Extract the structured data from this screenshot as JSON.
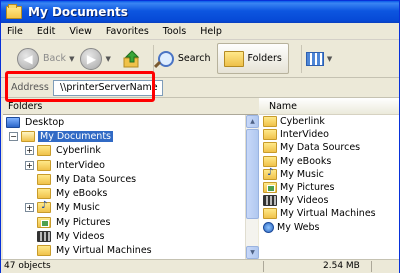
{
  "window": {
    "title": "My Documents"
  },
  "menubar": {
    "items": [
      "File",
      "Edit",
      "View",
      "Favorites",
      "Tools",
      "Help"
    ]
  },
  "toolbar": {
    "back_label": "Back",
    "search_label": "Search",
    "folders_label": "Folders"
  },
  "address": {
    "label": "Address",
    "value": "\\\\printerServerName"
  },
  "folders_pane": {
    "title": "Folders",
    "tree": [
      {
        "label": "Desktop",
        "icon": "desktop-icon"
      },
      {
        "label": "My Documents",
        "icon": "my-documents-icon",
        "selected": true
      },
      {
        "label": "Cyberlink",
        "icon": "folder-icon"
      },
      {
        "label": "InterVideo",
        "icon": "folder-icon"
      },
      {
        "label": "My Data Sources",
        "icon": "folder-icon"
      },
      {
        "label": "My eBooks",
        "icon": "folder-icon"
      },
      {
        "label": "My Music",
        "icon": "music-folder-icon"
      },
      {
        "label": "My Pictures",
        "icon": "pictures-folder-icon"
      },
      {
        "label": "My Videos",
        "icon": "videos-folder-icon"
      },
      {
        "label": "My Virtual Machines",
        "icon": "folder-icon"
      }
    ]
  },
  "file_pane": {
    "column_name": "Name",
    "files": [
      {
        "label": "Cyberlink",
        "icon": "folder-icon"
      },
      {
        "label": "InterVideo",
        "icon": "folder-icon"
      },
      {
        "label": "My Data Sources",
        "icon": "folder-icon"
      },
      {
        "label": "My eBooks",
        "icon": "folder-icon"
      },
      {
        "label": "My Music",
        "icon": "music-folder-icon"
      },
      {
        "label": "My Pictures",
        "icon": "pictures-folder-icon"
      },
      {
        "label": "My Videos",
        "icon": "videos-folder-icon"
      },
      {
        "label": "My Virtual Machines",
        "icon": "folder-icon"
      },
      {
        "label": "My Webs",
        "icon": "webs-folder-icon"
      }
    ]
  },
  "statusbar": {
    "objects": "47 objects",
    "size": "2.54 MB"
  },
  "colors": {
    "titlebar": "#0a5ce8",
    "selection": "#316ac5",
    "highlight_box": "#ff0000"
  }
}
